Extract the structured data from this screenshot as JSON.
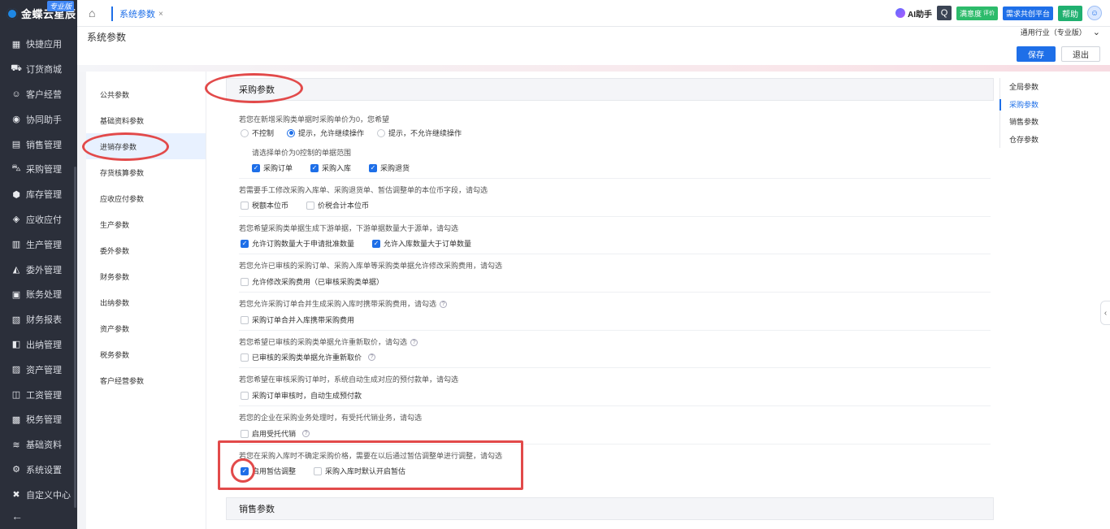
{
  "brand": {
    "name": "金蝶云星辰",
    "edition": "专业版"
  },
  "nav": {
    "items": [
      {
        "label": "快捷应用",
        "icon": "grid-icon",
        "glyph": "▦"
      },
      {
        "label": "订货商城",
        "icon": "cart-bag-icon",
        "glyph": "⛟"
      },
      {
        "label": "客户经营",
        "icon": "customer-icon",
        "glyph": "☺"
      },
      {
        "label": "协同助手",
        "icon": "assistant-icon",
        "glyph": "◉"
      },
      {
        "label": "销售管理",
        "icon": "sales-icon",
        "glyph": "▤"
      },
      {
        "label": "采购管理",
        "icon": "purchase-cart-icon",
        "glyph": "⛍"
      },
      {
        "label": "库存管理",
        "icon": "inventory-box-icon",
        "glyph": "⬢"
      },
      {
        "label": "应收应付",
        "icon": "receivable-icon",
        "glyph": "◈"
      },
      {
        "label": "生产管理",
        "icon": "factory-icon",
        "glyph": "▥"
      },
      {
        "label": "委外管理",
        "icon": "outsourcing-icon",
        "glyph": "◭"
      },
      {
        "label": "账务处理",
        "icon": "ledger-icon",
        "glyph": "▣"
      },
      {
        "label": "财务报表",
        "icon": "report-icon",
        "glyph": "▧"
      },
      {
        "label": "出纳管理",
        "icon": "cashier-icon",
        "glyph": "◧"
      },
      {
        "label": "资产管理",
        "icon": "asset-icon",
        "glyph": "▨"
      },
      {
        "label": "工资管理",
        "icon": "salary-icon",
        "glyph": "◫"
      },
      {
        "label": "税务管理",
        "icon": "tax-icon",
        "glyph": "▩"
      },
      {
        "label": "基础资料",
        "icon": "layers-icon",
        "glyph": "≋"
      },
      {
        "label": "系统设置",
        "icon": "settings-icon",
        "glyph": "⚙"
      },
      {
        "label": "自定义中心",
        "icon": "custom-center-icon",
        "glyph": "✖"
      }
    ],
    "collapse_icon": "←"
  },
  "topbar": {
    "home_icon": "⌂",
    "tab_label": "系统参数",
    "tab_close": "×",
    "ai_label": "AI助手",
    "search_icon": "Q",
    "green_badge": "满意度",
    "green_badge_sub": "评价",
    "blue_badge": "需求共创平台",
    "help_label": "帮助"
  },
  "header": {
    "title": "系统参数",
    "industry": "通用行业（专业版）",
    "industry_caret": "⌄",
    "save_label": "保存",
    "exit_label": "退出"
  },
  "categories": [
    "公共参数",
    "基础资料参数",
    "进销存参数",
    "存货核算参数",
    "应收应付参数",
    "生产参数",
    "委外参数",
    "财务参数",
    "出纳参数",
    "资产参数",
    "税务参数",
    "客户经营参数"
  ],
  "active_category": "进销存参数",
  "anchors": [
    "全局参数",
    "采购参数",
    "销售参数",
    "仓存参数"
  ],
  "active_anchor": "采购参数",
  "section": {
    "title": "采购参数",
    "g1": {
      "title": "若您在新增采购类单据时采购单价为0，您希望",
      "r1": "不控制",
      "r2": "提示，允许继续操作",
      "r3": "提示，不允许继续操作",
      "sub": "请选择单价为0控制的单据范围",
      "c1": "采购订单",
      "c2": "采购入库",
      "c3": "采购退货"
    },
    "g2": {
      "title": "若需要手工修改采购入库单、采购退货单、暂估调整单的本位币字段，请勾选",
      "c1": "税额本位币",
      "c2": "价税合计本位币"
    },
    "g3": {
      "title": "若您希望采购类单据生成下游单据，下游单据数量大于源单，请勾选",
      "c1": "允许订购数量大于申请批准数量",
      "c2": "允许入库数量大于订单数量"
    },
    "g4": {
      "title": "若您允许已审核的采购订单、采购入库单等采购类单据允许修改采购费用，请勾选",
      "c1": "允许修改采购费用（已审核采购类单据）"
    },
    "g5": {
      "title": "若您允许采购订单合并生成采购入库时携带采购费用，请勾选",
      "c1": "采购订单合并入库携带采购费用"
    },
    "g6": {
      "title": "若您希望已审核的采购类单据允许重新取价，请勾选",
      "c1": "已审核的采购类单据允许重新取价"
    },
    "g7": {
      "title": "若您希望在审核采购订单时，系统自动生成对应的预付款单，请勾选",
      "c1": "采购订单审核时，自动生成预付款"
    },
    "g8": {
      "title": "若您的企业在采购业务处理时，有受托代销业务，请勾选",
      "c1": "启用受托代销"
    },
    "g9": {
      "title": "若您在采购入库时不确定采购价格，需要在以后通过暂估调整单进行调整，请勾选",
      "c1": "启用暂估调整",
      "c2": "采购入库时默认开启暂估"
    }
  },
  "next_section": {
    "title": "销售参数"
  },
  "check_glyph": "✓",
  "help_glyph": "?",
  "side_toggle": "‹"
}
